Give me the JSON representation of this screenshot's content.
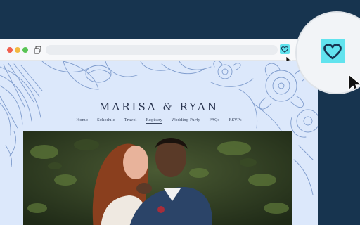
{
  "site": {
    "title": "MARISA & RYAN",
    "nav": [
      {
        "label": "Home",
        "active": false
      },
      {
        "label": "Schedule",
        "active": false
      },
      {
        "label": "Travel",
        "active": false
      },
      {
        "label": "Registry",
        "active": true
      },
      {
        "label": "Wedding Party",
        "active": false
      },
      {
        "label": "FAQs",
        "active": false
      },
      {
        "label": "RSVPs",
        "active": false
      }
    ]
  },
  "browser": {
    "controls": [
      "close",
      "minimize",
      "maximize"
    ],
    "extension_icon": "heart-icon"
  },
  "colors": {
    "background": "#17344f",
    "page_background": "#dce8fb",
    "extension_accent": "#61e3ee",
    "floral_line": "#7f9ccd",
    "title_text": "#2a3550"
  }
}
